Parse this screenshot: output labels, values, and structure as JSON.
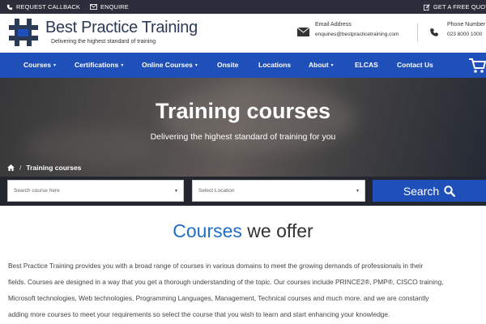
{
  "topbar": {
    "callback_label": "REQUEST CALLBACK",
    "enquire_label": "ENQUIRE",
    "quote_label": "GET A FREE QUOTE"
  },
  "header": {
    "brand": "Best Practice Training",
    "tagline": "Delivering the highest standard of training",
    "email_title": "Email Address",
    "email_value": "enquiries@bestpracticetraining.com",
    "phone_title": "Phone Number",
    "phone_value": "023 8000 1000"
  },
  "nav": {
    "items": [
      {
        "label": "Courses",
        "dropdown": true
      },
      {
        "label": "Certifications",
        "dropdown": true
      },
      {
        "label": "Online Courses",
        "dropdown": true
      },
      {
        "label": "Onsite",
        "dropdown": false
      },
      {
        "label": "Locations",
        "dropdown": false
      },
      {
        "label": "About",
        "dropdown": true
      },
      {
        "label": "ELCAS",
        "dropdown": false
      },
      {
        "label": "Contact Us",
        "dropdown": false
      }
    ]
  },
  "hero": {
    "title": "Training courses",
    "subtitle": "Delivering the highest standard of training for you",
    "breadcrumb_current": "Training courses"
  },
  "search": {
    "course_placeholder": "Search course here",
    "location_placeholder": "Select Location",
    "button_label": "Search"
  },
  "content": {
    "heading_accent": "Courses",
    "heading_rest": " we offer",
    "lines": [
      "Best Practice Training provides you with a broad range of courses in various domains to meet the growing demands of professionals in their",
      "fields. Courses are designed in a way that you get a thorough understanding of the topic. Our courses include PRINCE2®, PMP®, CISCO training,",
      "Microsoft technologies, Web technologies, Programming Languages, Management, Technical courses and much more. and we are constantly",
      "adding more courses to meet your requirements so select the course that you wish to learn and start enhancing your knowledge."
    ]
  },
  "colors": {
    "nav_blue": "#1f4fb8",
    "topbar_dark": "#2b2d3a",
    "accent_blue": "#1f6fc8"
  }
}
